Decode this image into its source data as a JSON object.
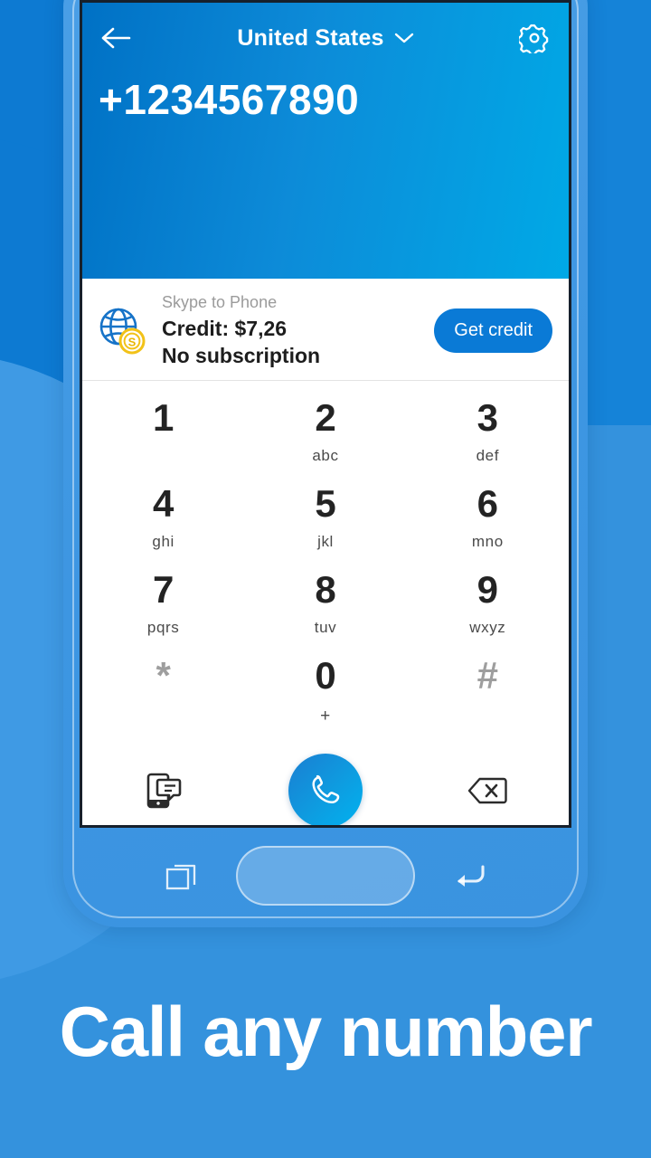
{
  "colors": {
    "background": "#3492dd",
    "background_dark": "#0d7ad2",
    "background_light": "#3f9ae4",
    "header_gradient_start": "#0071c5",
    "header_gradient_end": "#00a9e6",
    "accent_blue": "#0a7ad6",
    "call_button_start": "#1a7ed2",
    "call_button_end": "#00b2f0",
    "device_body": "#3d96e2",
    "coin_gold": "#f2c218",
    "globe_blue": "#1673c8",
    "key_digit": "#232323",
    "key_muted": "#9e9e9e"
  },
  "header": {
    "back_icon": "arrow-left-icon",
    "country": "United States",
    "dropdown_icon": "chevron-down-icon",
    "settings_icon": "gear-icon",
    "phone_number": "+1234567890"
  },
  "credit": {
    "icon": "globe-coin-icon",
    "title": "Skype to Phone",
    "amount": "Credit: $7,26",
    "subscription": "No subscription",
    "button_label": "Get credit"
  },
  "keypad": {
    "keys": [
      {
        "digit": "1",
        "letters": "",
        "muted": false
      },
      {
        "digit": "2",
        "letters": "abc",
        "muted": false
      },
      {
        "digit": "3",
        "letters": "def",
        "muted": false
      },
      {
        "digit": "4",
        "letters": "ghi",
        "muted": false
      },
      {
        "digit": "5",
        "letters": "jkl",
        "muted": false
      },
      {
        "digit": "6",
        "letters": "mno",
        "muted": false
      },
      {
        "digit": "7",
        "letters": "pqrs",
        "muted": false
      },
      {
        "digit": "8",
        "letters": "tuv",
        "muted": false
      },
      {
        "digit": "9",
        "letters": "wxyz",
        "muted": false
      },
      {
        "digit": "*",
        "letters": "",
        "muted": true
      },
      {
        "digit": "0",
        "letters": "+",
        "muted": false
      },
      {
        "digit": "#",
        "letters": "",
        "muted": true
      }
    ]
  },
  "actions": {
    "sms_icon": "phone-message-icon",
    "call_icon": "phone-handset-icon",
    "backspace_icon": "backspace-icon"
  },
  "navbar": {
    "recents_icon": "recents-icon",
    "home_label": "home-button",
    "back_icon": "back-arrow-icon"
  },
  "caption": {
    "text": "Call any number"
  }
}
